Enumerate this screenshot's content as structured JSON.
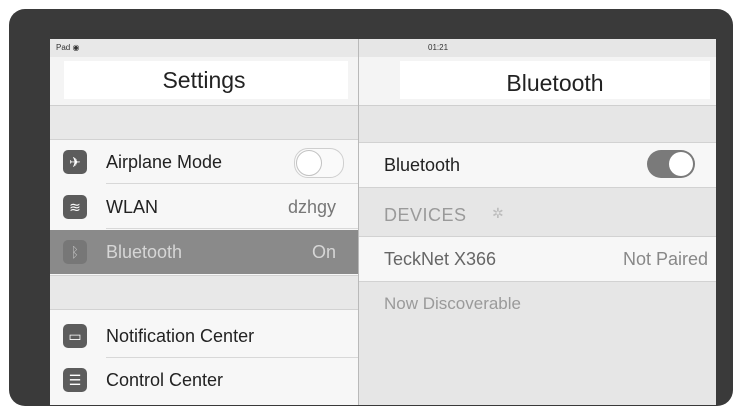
{
  "status": {
    "left": "Pad ◉",
    "time": "01:21"
  },
  "left": {
    "title": "Settings",
    "group1": [
      {
        "label": "Airplane Mode",
        "icon": "airplane-icon",
        "toggle": "off"
      },
      {
        "label": "WLAN",
        "icon": "wifi-icon",
        "value": "dzhgy"
      },
      {
        "label": "Bluetooth",
        "icon": "bluetooth-icon",
        "value": "On",
        "selected": true
      }
    ],
    "group2": [
      {
        "label": "Notification Center",
        "icon": "notification-icon"
      },
      {
        "label": "Control Center",
        "icon": "control-center-icon"
      }
    ]
  },
  "right": {
    "title": "Bluetooth",
    "bluetooth_label": "Bluetooth",
    "bluetooth_toggle": "on",
    "devices_header": "DEVICES",
    "devices": [
      {
        "name": "TeckNet X366",
        "status": "Not Paired"
      }
    ],
    "discoverable_note": "Now Discoverable"
  }
}
